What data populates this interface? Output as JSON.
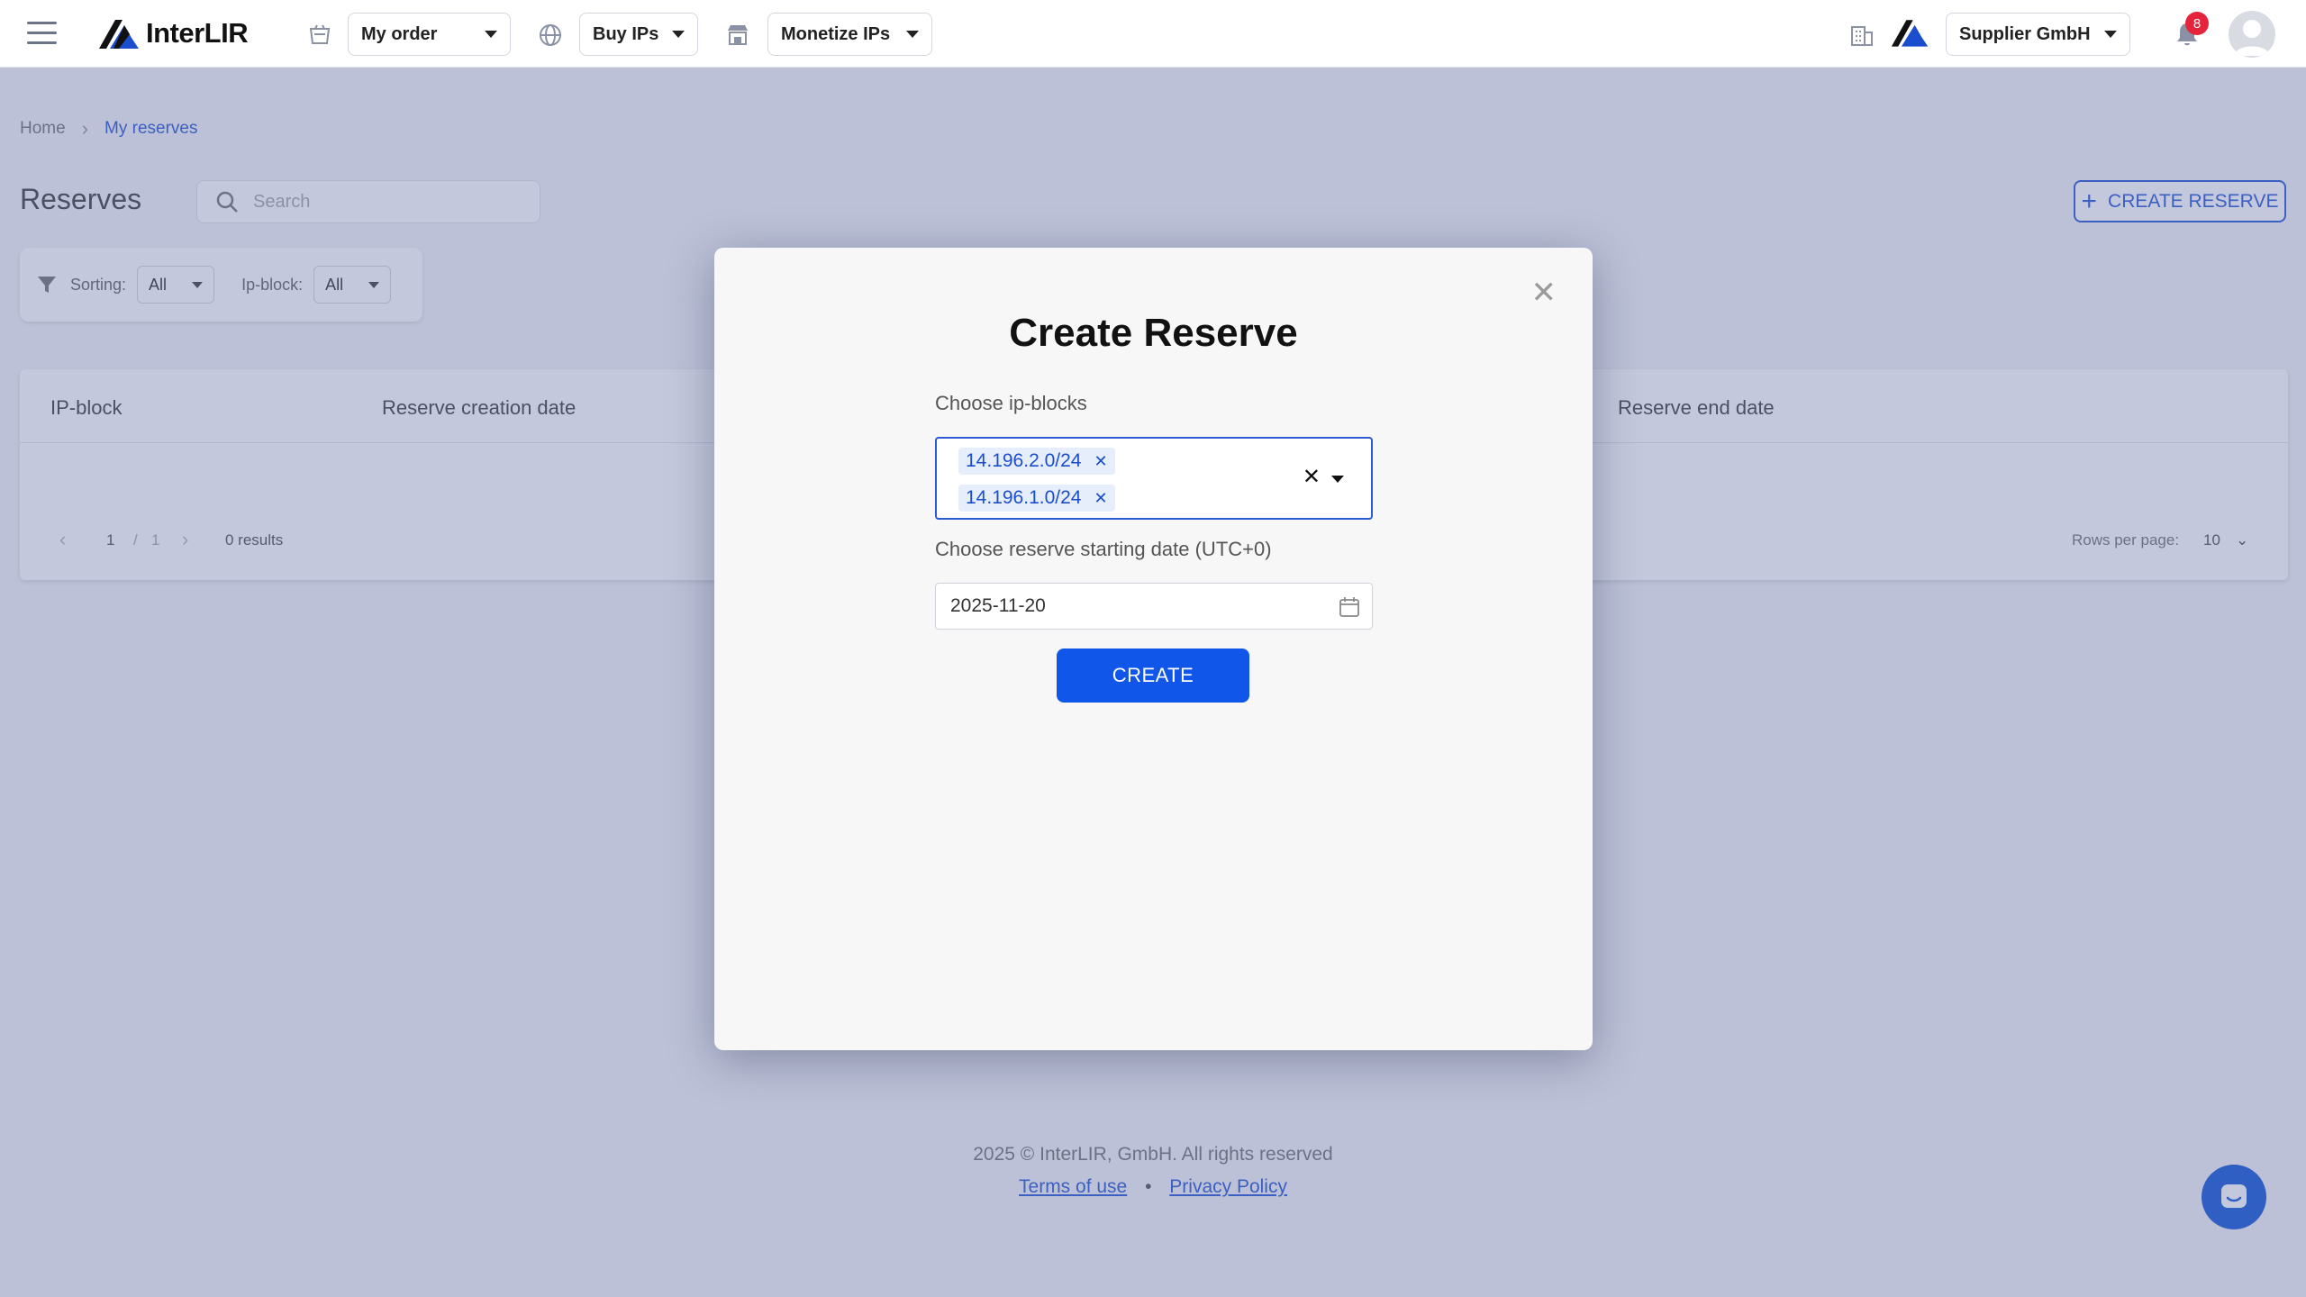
{
  "topbar": {
    "brand": "InterLIR",
    "my_order": "My order",
    "buy_ips": "Buy IPs",
    "monetize_ips": "Monetize IPs",
    "company": "Supplier GmbH",
    "notifications_count": "8"
  },
  "breadcrumb": {
    "home": "Home",
    "current": "My reserves"
  },
  "page": {
    "title": "Reserves",
    "search_placeholder": "Search",
    "create_reserve": "CREATE RESERVE"
  },
  "filters": {
    "sorting_label": "Sorting:",
    "sorting_value": "All",
    "ipblock_label": "Ip-block:",
    "ipblock_value": "All"
  },
  "table": {
    "columns": [
      "IP-block",
      "Reserve creation date",
      "Reserve end date"
    ],
    "page_current": "1",
    "page_sep": "/",
    "page_total": "1",
    "results": "0 results",
    "rows_per_page_label": "Rows per page:",
    "rows_per_page_value": "10"
  },
  "modal": {
    "title": "Create Reserve",
    "ipblocks_label": "Choose ip-blocks",
    "selected_ipblocks": [
      "14.196.2.0/24",
      "14.196.1.0/24"
    ],
    "date_label": "Choose reserve starting date (UTC+0)",
    "date_value": "2025-11-20",
    "create_button": "CREATE"
  },
  "footer": {
    "copyright": "2025 © InterLIR, GmbH. All rights reserved",
    "terms": "Terms of use",
    "separator": "•",
    "privacy": "Privacy Policy"
  },
  "colors": {
    "accent": "#2d5bd6",
    "primary_button": "#0f56e9",
    "badge": "#e5243b"
  }
}
